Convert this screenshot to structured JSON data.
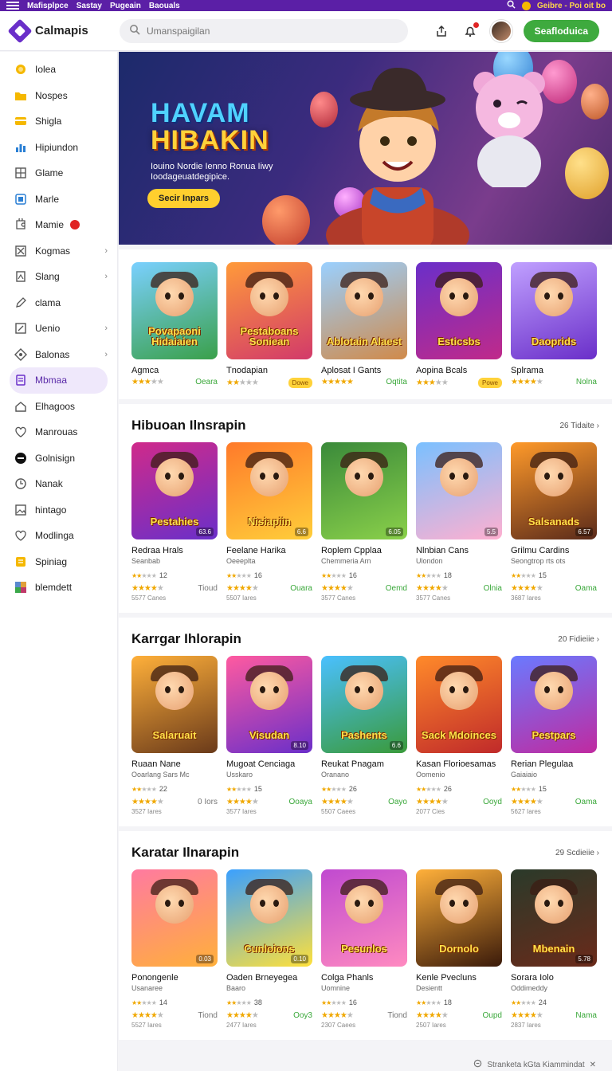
{
  "topbar": {
    "left_items": [
      "Mafisplpce",
      "Sastay",
      "Pugeain",
      "Baouals"
    ],
    "promo": "Geibre - Poi oit bo"
  },
  "header": {
    "logo": "Calmapis",
    "search_placeholder": "Umanspaigilan",
    "cta": "Seafloduica"
  },
  "sidebar": {
    "items": [
      {
        "label": "Iolea",
        "icon": "coin-icon",
        "color": "#f5b800"
      },
      {
        "label": "Nospes",
        "icon": "folder-icon",
        "color": "#f5b800"
      },
      {
        "label": "Shigla",
        "icon": "card-icon",
        "color": "#f5b800"
      },
      {
        "label": "Hipiundon",
        "icon": "chart-icon",
        "color": "#2a7fd4"
      },
      {
        "label": "Glame",
        "icon": "grid-icon",
        "color": "#555"
      },
      {
        "label": "Marle",
        "icon": "tablet-icon",
        "color": "#2a7fd4"
      },
      {
        "label": "Mamie",
        "icon": "puzzle-icon",
        "color": "#555",
        "badge": true
      },
      {
        "label": "Kogmas",
        "icon": "x-box-icon",
        "color": "#555",
        "chevron": true
      },
      {
        "label": "Slang",
        "icon": "book-icon",
        "color": "#555",
        "chevron": true
      },
      {
        "label": "clama",
        "icon": "pen-icon",
        "color": "#555"
      },
      {
        "label": "Uenio",
        "icon": "window-icon",
        "color": "#555",
        "chevron": true
      },
      {
        "label": "Balonas",
        "icon": "diamond-icon",
        "color": "#555",
        "chevron": true
      },
      {
        "label": "Mbmaa",
        "icon": "doc-icon",
        "color": "#6a2fc9",
        "active": true
      },
      {
        "label": "Elhagoos",
        "icon": "home-icon",
        "color": "#555"
      },
      {
        "label": "Manrouas",
        "icon": "heart-icon",
        "color": "#555"
      },
      {
        "label": "Golnisign",
        "icon": "disc-icon",
        "color": "#111"
      },
      {
        "label": "Nanak",
        "icon": "clock-icon",
        "color": "#555"
      },
      {
        "label": "hintago",
        "icon": "image-icon",
        "color": "#555"
      },
      {
        "label": "Modlinga",
        "icon": "heart-icon",
        "color": "#555"
      },
      {
        "label": "Spiniag",
        "icon": "list-icon",
        "color": "#f5b800"
      },
      {
        "label": "blemdett",
        "icon": "pixel-icon",
        "color": "#3a8"
      }
    ]
  },
  "hero": {
    "title_line1": "HAVAM",
    "title_line2": "HIBAKIN",
    "subtitle": "Iouino Nordie Ienno Ronua Iiwy Ioodageuatdegipice.",
    "button": "Secir Inpars"
  },
  "featured": {
    "cards": [
      {
        "name": "Agmca",
        "art": "Povapaoni Hidaiaien",
        "stars": 3,
        "price": "Oeara",
        "pill": null,
        "bg": "linear-gradient(160deg,#7ad0ff,#3aa04a)"
      },
      {
        "name": "Tnodapian",
        "art": "Pestaboans Soniean",
        "stars": 2,
        "price": null,
        "pill": "Dowe",
        "bg": "linear-gradient(160deg,#ff9a3a,#d23a6a)"
      },
      {
        "name": "Aplosat I Gants",
        "art": "Ablotain Alaest",
        "stars": 5,
        "price": "Oqtita",
        "pill": null,
        "bg": "linear-gradient(160deg,#9ad0ff,#d08a4a)"
      },
      {
        "name": "Aopina Bcals",
        "art": "Esticsbs",
        "stars": 3,
        "price": null,
        "pill": "Powe",
        "bg": "linear-gradient(160deg,#6a2fc9,#c02a8a)"
      },
      {
        "name": "Splrama",
        "art": "Daoprids",
        "stars": 4,
        "price": "Nolna",
        "pill": null,
        "bg": "linear-gradient(160deg,#c0a0ff,#6a2fc9)"
      }
    ]
  },
  "sections": [
    {
      "title": "Hibuoan Ilnsrapin",
      "link": "26 Tidaite",
      "cards": [
        {
          "name": "Redraa Hrals",
          "sub": "Seanbab",
          "rating": "12",
          "stars": 4,
          "price": "Tioud",
          "count": "5577 Canes",
          "art": "Pestahies",
          "rt": "63.6",
          "bg": "linear-gradient(160deg,#d02a8a,#6a2fc9)"
        },
        {
          "name": "Feelane Harika",
          "sub": "Oeeeplta",
          "rating": "16",
          "stars": 4,
          "price": "Ouara",
          "count": "5507 Iares",
          "art": "Nisiapiin",
          "rt": "6.6",
          "bg": "linear-gradient(160deg,#ff7a2a,#ffce3a)"
        },
        {
          "name": "Roplem Cpplaa",
          "sub": "Chemmeria Arn",
          "rating": "16",
          "stars": 4,
          "price": "Oemd",
          "count": "3577 Canes",
          "art": "",
          "rt": "6.05",
          "bg": "linear-gradient(160deg,#3a8a3a,#8ad04a)"
        },
        {
          "name": "Nlnbian Cans",
          "sub": "Ulondon",
          "rating": "18",
          "stars": 4,
          "price": "Olnia",
          "count": "3577 Canes",
          "art": "",
          "rt": "5.5",
          "bg": "linear-gradient(160deg,#7ac0ff,#ffb0d0)"
        },
        {
          "name": "Grilmu Cardins",
          "sub": "Seongtrop rts ots",
          "rating": "15",
          "stars": 4,
          "price": "Oama",
          "count": "3687 Iares",
          "art": "Salsanads",
          "rt": "6.57",
          "bg": "linear-gradient(160deg,#ff9a2a,#5a2a1a)"
        }
      ]
    },
    {
      "title": "Karrgar Ihlorapin",
      "link": "20 Fidieiie",
      "cards": [
        {
          "name": "Ruaan Nane",
          "sub": "Ooarlang Sars Mc",
          "rating": "22",
          "stars": 4,
          "price": "0 Iors",
          "count": "3527 Iares",
          "art": "Salaruait",
          "rt": "",
          "bg": "linear-gradient(160deg,#ffb03a,#6a3a1a)"
        },
        {
          "name": "Mugoat Cenciaga",
          "sub": "Usskaro",
          "rating": "15",
          "stars": 4,
          "price": "Ooaya",
          "count": "3577 Iares",
          "art": "Visudan",
          "rt": "8.10",
          "bg": "linear-gradient(160deg,#ff5aa0,#6a2fc9)"
        },
        {
          "name": "Reukat Pnagam",
          "sub": "Oranano",
          "rating": "26",
          "stars": 4,
          "price": "Oayo",
          "count": "5507 Caees",
          "art": "Pashents",
          "rt": "6.6",
          "bg": "linear-gradient(160deg,#4ac0ff,#3a9a3a)"
        },
        {
          "name": "Kasan Florioesamas",
          "sub": "Oomenio",
          "rating": "26",
          "stars": 4,
          "price": "Ooyd",
          "count": "2077 Cies",
          "art": "Sack Mdoinces",
          "rt": "",
          "bg": "linear-gradient(160deg,#ff8a2a,#c02a2a)"
        },
        {
          "name": "Rerian Plegulaa",
          "sub": "Gaiaiaio",
          "rating": "15",
          "stars": 4,
          "price": "Oama",
          "count": "5627 Iares",
          "art": "Pestpars",
          "rt": "",
          "bg": "linear-gradient(160deg,#6a7aff,#c02aa0)"
        }
      ]
    },
    {
      "title": "Karatar Ilnarapin",
      "link": "29 Scdieiie",
      "cards": [
        {
          "name": "Ponongenle",
          "sub": "Usanaree",
          "rating": "14",
          "stars": 4,
          "price": "Tiond",
          "count": "5527 Iares",
          "art": "",
          "rt": "0.03",
          "bg": "linear-gradient(160deg,#ff7aa0,#ffb03a)"
        },
        {
          "name": "Oaden Brneyegea",
          "sub": "Baaro",
          "rating": "38",
          "stars": 4,
          "price": "Ooy3",
          "count": "2477 Iares",
          "art": "Cunloions",
          "rt": "0.10",
          "bg": "linear-gradient(160deg,#3aa0ff,#ffe03a)"
        },
        {
          "name": "Colga Phanls",
          "sub": "Uomnine",
          "rating": "16",
          "stars": 4,
          "price": "Tiond",
          "count": "2307 Caees",
          "art": "Pesunlos",
          "rt": "",
          "bg": "linear-gradient(160deg,#c04ad0,#ff8ac0)"
        },
        {
          "name": "Kenle Pvecluns",
          "sub": "Desientt",
          "rating": "18",
          "stars": 4,
          "price": "Oupd",
          "count": "2507 Iares",
          "art": "Dornolo",
          "rt": "",
          "bg": "linear-gradient(160deg,#ffb03a,#3a1a0a)"
        },
        {
          "name": "Sorara Iolo",
          "sub": "Oddimeddy",
          "rating": "24",
          "stars": 4,
          "price": "Nama",
          "count": "2837 Iares",
          "art": "Mbenain",
          "rt": "5.78",
          "bg": "linear-gradient(160deg,#2a3a2a,#6a2a1a)"
        }
      ]
    }
  ],
  "footer_note": "Stranketa kGta Kiammindat"
}
